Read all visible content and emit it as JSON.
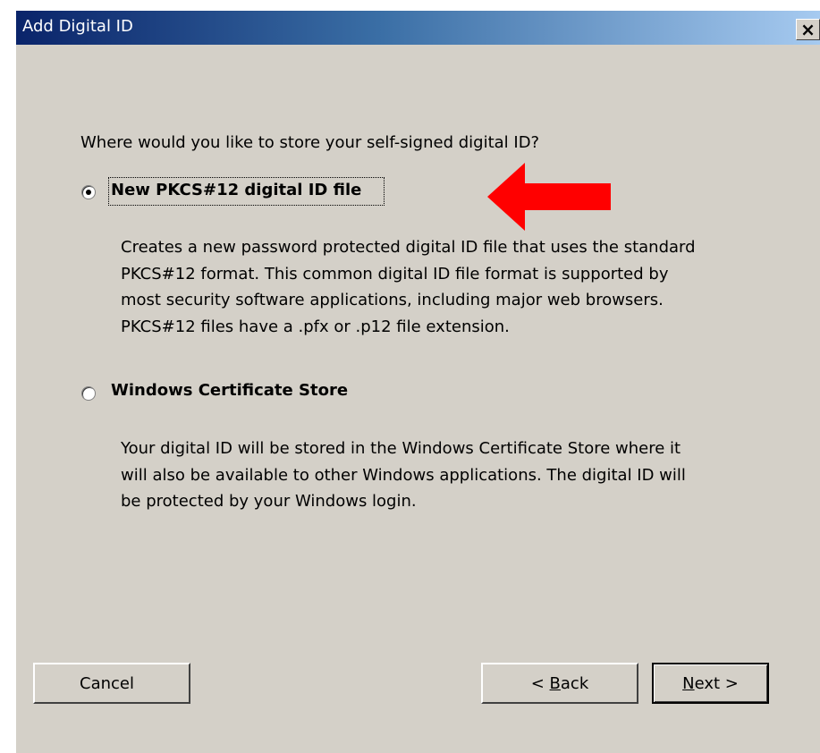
{
  "window": {
    "title": "Add Digital ID",
    "close_glyph": "×"
  },
  "main": {
    "question": "Where would you like to store your self-signed digital ID?",
    "options": [
      {
        "label": "New PKCS#12 digital ID file",
        "selected": true,
        "description_lines": [
          "Creates a new password protected digital ID file that uses the standard",
          "PKCS#12 format. This common digital ID file format is supported by",
          "most security software applications, including major web browsers.",
          "PKCS#12 files have a .pfx or .p12 file extension."
        ]
      },
      {
        "label": "Windows Certificate Store",
        "selected": false,
        "description_lines": [
          "Your digital ID will be stored in the Windows Certificate Store where it",
          "will also be available to other Windows applications. The digital ID will",
          "be protected by your Windows login."
        ]
      }
    ]
  },
  "footer": {
    "cancel_label": "Cancel",
    "back_prefix": "< ",
    "back_mnemonic": "B",
    "back_rest": "ack",
    "next_mnemonic": "N",
    "next_rest": "ext >"
  },
  "colors": {
    "dialog_bg": "#d4d0c8",
    "title_gradient_start": "#0a246a",
    "title_gradient_end": "#a6caf0",
    "annotation_arrow": "#ff0000"
  },
  "icons": {
    "close": "close-icon",
    "annotation": "arrow-left-icon"
  }
}
